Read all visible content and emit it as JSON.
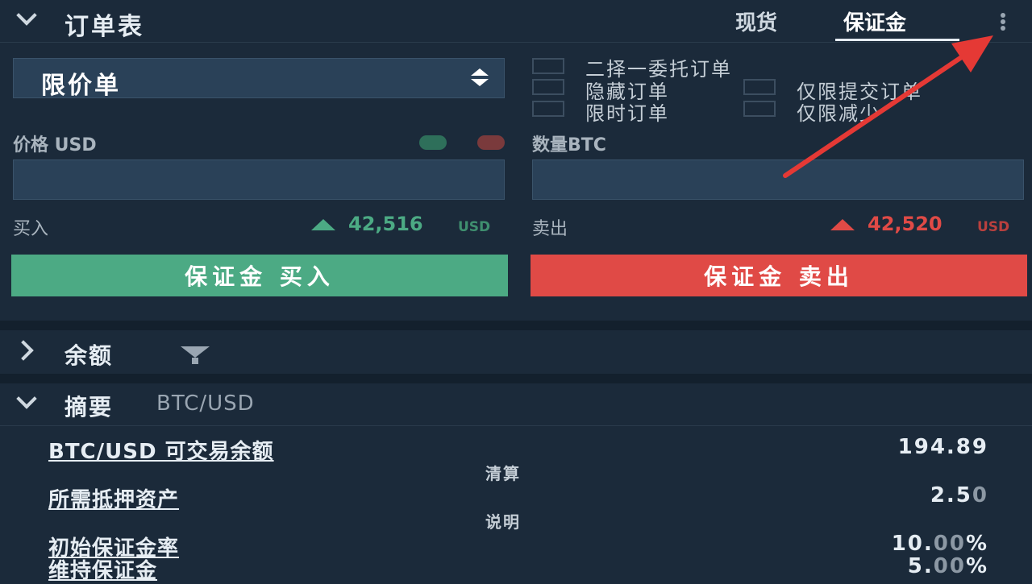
{
  "header": {
    "title": "订单表",
    "tabs": [
      {
        "label": "现货",
        "active": false
      },
      {
        "label": "保证金",
        "active": true
      }
    ]
  },
  "order_form": {
    "order_type": "限价单",
    "options": {
      "oco": "二择一委托订单",
      "hidden": "隐藏订单",
      "post_only": "仅限提交订单",
      "tif": "限时订单",
      "reduce_only": "仅限减少"
    },
    "price_label": "价格 USD",
    "amount_label": "数量BTC",
    "price_value": "",
    "amount_value": "",
    "buy_label": "买入",
    "buy_price": "42,516",
    "buy_unit": "USD",
    "sell_label": "卖出",
    "sell_price": "42,520",
    "sell_unit": "USD",
    "buy_button": "保证金 买入",
    "sell_button": "保证金 卖出"
  },
  "balance_section": {
    "title": "余额"
  },
  "summary_section": {
    "title": "摘要",
    "pair": "BTC/USD",
    "rows": [
      {
        "label": "BTC/USD 可交易余额",
        "value_main": "194.89",
        "value_dim": ""
      },
      {
        "label": "所需抵押资产",
        "value_main": "2.5",
        "value_dim": "0"
      },
      {
        "label": "初始保证金率",
        "value_main": "10.",
        "value_dim": "00",
        "value_suffix": "%"
      },
      {
        "label": "维持保证金",
        "value_main": "5.",
        "value_dim": "00",
        "value_suffix": "%"
      }
    ],
    "notes": [
      "清算",
      "说明"
    ]
  },
  "colors": {
    "background": "#1b2a3a",
    "buy": "#4caa84",
    "sell": "#e04a46",
    "annotation_arrow": "#e53935"
  }
}
